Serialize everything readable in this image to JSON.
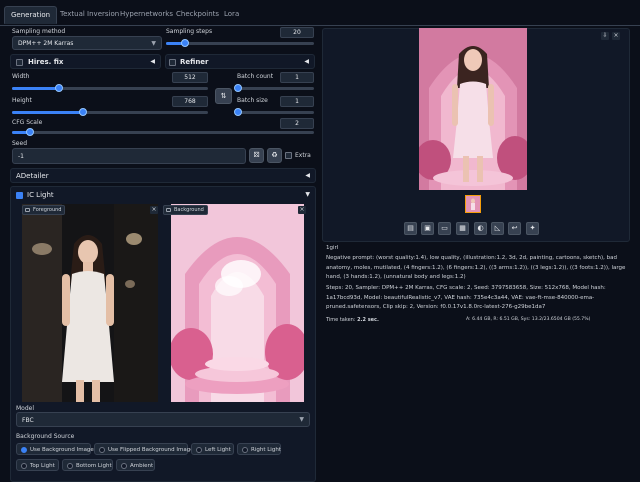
{
  "tabs": [
    "Generation",
    "Textual Inversion",
    "Hypernetworks",
    "Checkpoints",
    "Lora"
  ],
  "sampling": {
    "method_label": "Sampling method",
    "method_value": "DPM++ 2M Karras",
    "steps_label": "Sampling steps",
    "steps_value": "20",
    "steps_fraction": 0.13
  },
  "hires_fix": {
    "label": "Hires. fix",
    "checked": false
  },
  "refiner": {
    "label": "Refiner",
    "checked": false
  },
  "width": {
    "label": "Width",
    "value": "512",
    "fraction": 0.24
  },
  "height": {
    "label": "Height",
    "value": "768",
    "fraction": 0.36
  },
  "swap_icon": "swap-icon",
  "batch_count": {
    "label": "Batch count",
    "value": "1",
    "fraction": 0.0
  },
  "batch_size": {
    "label": "Batch size",
    "value": "1",
    "fraction": 0.0
  },
  "cfg": {
    "label": "CFG Scale",
    "value": "2",
    "fraction": 0.06
  },
  "seed": {
    "label": "Seed",
    "value": "-1",
    "extra_label": "Extra"
  },
  "adetailer": {
    "label": "ADetailer"
  },
  "ic_light": {
    "label": "IC Light",
    "checked": true,
    "foreground_tag": "Foreground",
    "background_tag": "Background",
    "model_label": "Model",
    "model_value": "FBC",
    "bg_source_label": "Background Source",
    "bg_options": [
      "Use Background Image",
      "Use Flipped Background Image",
      "Left Light",
      "Right Light",
      "Top Light",
      "Bottom Light",
      "Ambient"
    ],
    "bg_selected": 0
  },
  "output": {
    "prompt": "1girl",
    "negative": "Negative prompt: (worst quality:1.4), low quality, (illustration:1.2, 3d, 2d, painting, cartoons, sketch), bad anatomy, moles, mutilated, (4 fingers:1.2), (6 fingers:1.2), ((3 arms:1.2)), ((3 legs:1.2)), ((3 foots:1.2)), large hand, (3 hands:1.2), (unnatural body and legs:1.2)",
    "params": "Steps: 20, Sampler: DPM++ 2M Karras, CFG scale: 2, Seed: 3797583658, Size: 512x768, Model hash: 1a17bcd93d, Model: beautifulRealistic_v7, VAE hash: 735e4c3a44, VAE: vae-ft-mse-840000-ema-pruned.safetensors, Clip skip: 2, Version: f0.0.17v1.8.0rc-latest-276-g29be1da7",
    "time_taken_label": "Time taken:",
    "time_taken_value": "2.2 sec.",
    "vram": "A: 6.44 GB, R: 6.51 GB, Sys: 13.2/23.6504 GB (55.7%)"
  },
  "colors": {
    "accent": "#3b82f6",
    "bg": "#0b0f19",
    "panel": "#111827"
  }
}
